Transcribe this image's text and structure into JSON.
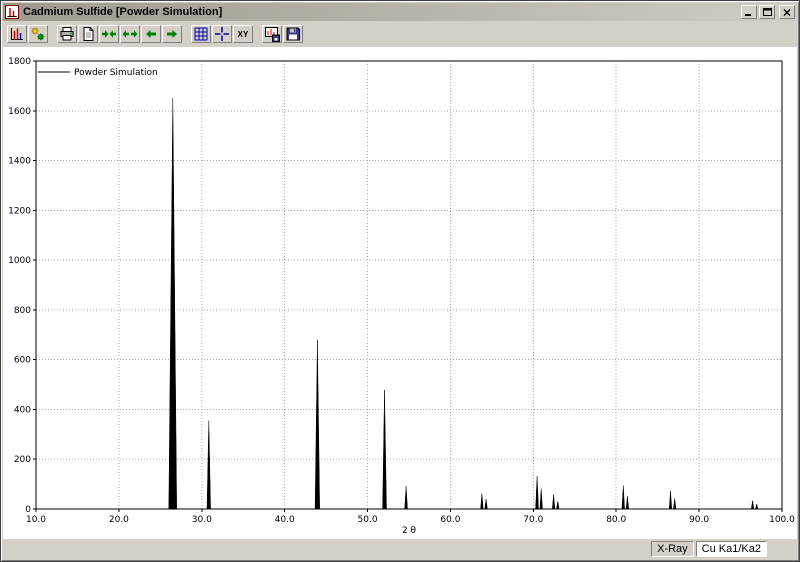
{
  "window": {
    "title": "Cadmium Sulfide [Powder Simulation]",
    "controls": [
      "minimize",
      "maximize",
      "close"
    ]
  },
  "toolbar": {
    "xy_label": "XY",
    "buttons": [
      "diffractogram",
      "settings",
      "printer",
      "document",
      "compress-x",
      "expand-x",
      "scroll-left",
      "scroll-right",
      "grid",
      "crosshair",
      "xy-values",
      "export-chart",
      "save"
    ]
  },
  "status_bar": {
    "radiation": "X-Ray",
    "wavelength": "Cu Ka1/Ka2"
  },
  "chart_data": {
    "type": "line",
    "title": "",
    "legend": [
      "Powder Simulation"
    ],
    "xlabel": "2 θ",
    "ylabel": "",
    "xlim": [
      10,
      100
    ],
    "ylim": [
      0,
      1800
    ],
    "x_ticks": [
      10,
      20,
      30,
      40,
      50,
      60,
      70,
      80,
      90,
      100
    ],
    "x_tick_labels": [
      "10.0",
      "20.0",
      "30.0",
      "40.0",
      "50.0",
      "60.0",
      "70.0",
      "80.0",
      "90.0",
      "100.0"
    ],
    "y_ticks": [
      0,
      200,
      400,
      600,
      800,
      1000,
      1200,
      1400,
      1600,
      1800
    ],
    "y_tick_labels": [
      "0",
      "200",
      "400",
      "600",
      "800",
      "1000",
      "1200",
      "1400",
      "1600",
      "1800"
    ],
    "grid": true,
    "grid_color": "#a8b0a8",
    "line_color": "#000000",
    "peaks": [
      {
        "two_theta": 26.5,
        "intensity": 1650
      },
      {
        "two_theta": 30.85,
        "intensity": 355
      },
      {
        "two_theta": 43.95,
        "intensity": 680
      },
      {
        "two_theta": 52.05,
        "intensity": 478
      },
      {
        "two_theta": 54.65,
        "intensity": 92
      },
      {
        "two_theta": 63.8,
        "intensity": 62
      },
      {
        "two_theta": 64.3,
        "intensity": 40
      },
      {
        "two_theta": 70.45,
        "intensity": 132
      },
      {
        "two_theta": 70.95,
        "intensity": 82
      },
      {
        "two_theta": 72.45,
        "intensity": 58
      },
      {
        "two_theta": 72.95,
        "intensity": 32
      },
      {
        "two_theta": 80.85,
        "intensity": 95
      },
      {
        "two_theta": 81.35,
        "intensity": 52
      },
      {
        "two_theta": 86.55,
        "intensity": 72
      },
      {
        "two_theta": 87.05,
        "intensity": 42
      },
      {
        "two_theta": 96.45,
        "intensity": 34
      },
      {
        "two_theta": 96.95,
        "intensity": 20
      }
    ]
  }
}
